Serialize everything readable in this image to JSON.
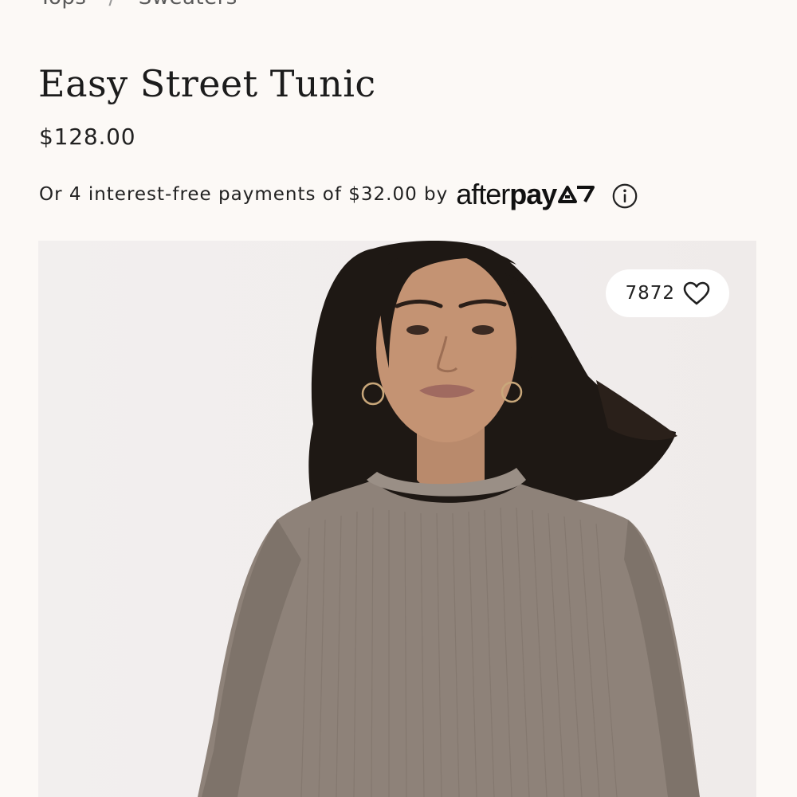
{
  "breadcrumb": {
    "items": [
      "Tops",
      "Sweaters"
    ],
    "separator": "/"
  },
  "product": {
    "title": "Easy Street Tunic",
    "price": "$128.00"
  },
  "afterpay": {
    "text": "Or 4 interest-free payments of $32.00 by",
    "logo_after": "after",
    "logo_pay": "pay",
    "info_icon": "info-circle-icon"
  },
  "gallery": {
    "favorites_count": "7872",
    "favorite_icon": "heart-icon"
  },
  "colors": {
    "background": "#fcf9f6",
    "text": "#1f1f1f",
    "sweater": "#8e8279",
    "hair": "#1e1814"
  }
}
